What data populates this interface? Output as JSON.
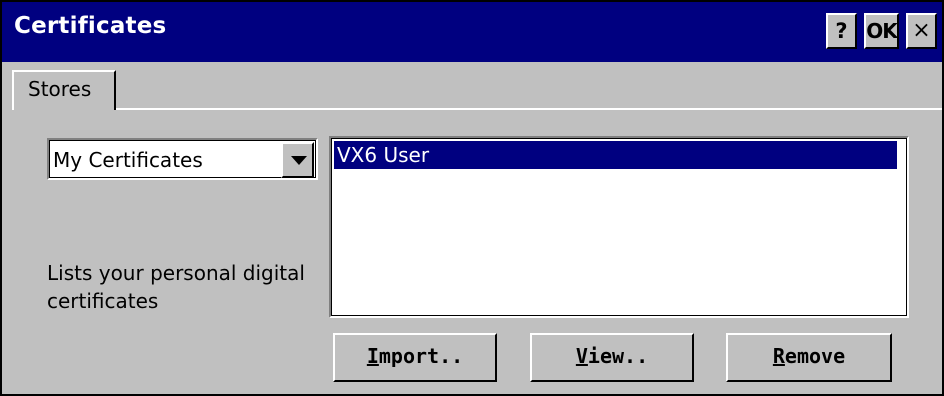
{
  "window": {
    "title": "Certificates"
  },
  "titlebar_buttons": {
    "help": "?",
    "ok": "OK",
    "close": "×"
  },
  "tabs": [
    {
      "label": "Stores"
    }
  ],
  "store_dropdown": {
    "value": "My Certificates"
  },
  "description": "Lists your personal digital certificates",
  "certificate_list": {
    "items": [
      {
        "label": "VX6 User",
        "selected": true
      }
    ]
  },
  "buttons": {
    "import": "Import..",
    "view": "View..",
    "remove": "Remove"
  },
  "colors": {
    "titlebar": "#000080",
    "face": "#c0c0c0",
    "selection": "#000080"
  }
}
